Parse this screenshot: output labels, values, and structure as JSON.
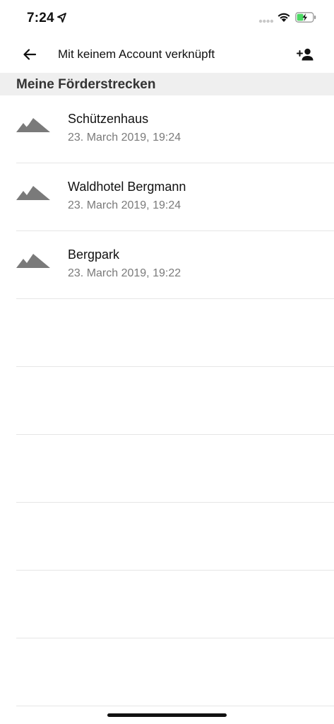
{
  "status_bar": {
    "time": "7:24",
    "icons": [
      "location-arrow-icon",
      "signal-dots-icon",
      "wifi-icon",
      "battery-charging-icon"
    ],
    "battery_color": "#4cd964"
  },
  "header": {
    "title": "Mit keinem Account verknüpft",
    "back_icon": "arrow-left-icon",
    "add_icon": "person-add-icon"
  },
  "section": {
    "title": "Meine Förderstrecken"
  },
  "list": {
    "items": [
      {
        "title": "Schützenhaus",
        "subtitle": "23. March 2019, 19:24",
        "icon": "mountain-icon"
      },
      {
        "title": "Waldhotel Bergmann",
        "subtitle": "23. March 2019, 19:24",
        "icon": "mountain-icon"
      },
      {
        "title": "Bergpark",
        "subtitle": "23. March 2019, 19:22",
        "icon": "mountain-icon"
      }
    ]
  },
  "colors": {
    "icon_gray": "#7a7a7a",
    "section_bg": "#efefef",
    "divider": "#e6e6e6"
  }
}
